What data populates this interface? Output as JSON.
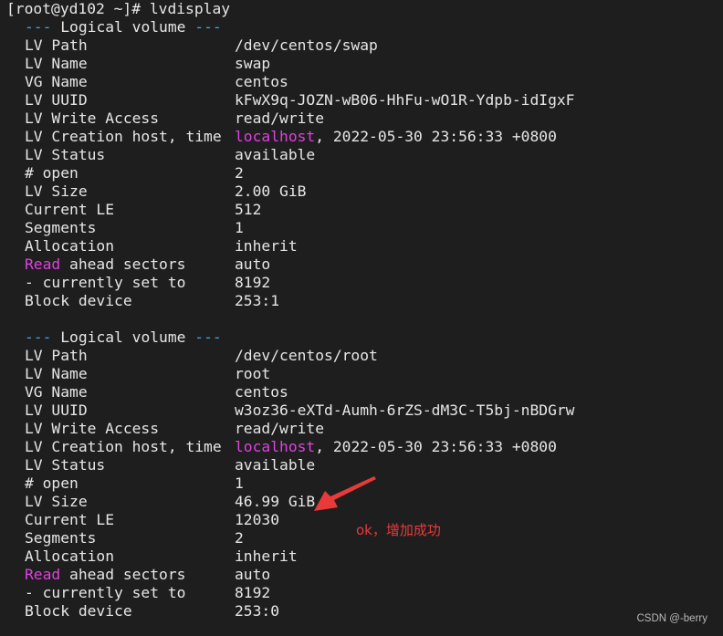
{
  "prompt": "[root@yd102 ~]# lvdisplay",
  "volumes": [
    {
      "header": {
        "dashes_left": "---",
        "title": "Logical volume",
        "dashes_right": "---"
      },
      "fields": [
        {
          "label": "LV Path",
          "value": "/dev/centos/swap"
        },
        {
          "label": "LV Name",
          "value": "swap"
        },
        {
          "label": "VG Name",
          "value": "centos"
        },
        {
          "label": "LV UUID",
          "value": "kFwX9q-JOZN-wB06-HhFu-wO1R-Ydpb-idIgxF"
        },
        {
          "label": "LV Write Access",
          "value": "read/write"
        },
        {
          "label": "LV Creation host, time",
          "value_host": "localhost",
          "value": ", 2022-05-30 23:56:33 +0800"
        },
        {
          "label": "LV Status",
          "value": "available"
        },
        {
          "label": "# open",
          "value": "2"
        },
        {
          "label": "LV Size",
          "value": "2.00 GiB"
        },
        {
          "label": "Current LE",
          "value": "512"
        },
        {
          "label": "Segments",
          "value": "1"
        },
        {
          "label": "Allocation",
          "value": "inherit"
        },
        {
          "label_hl": "Read",
          "label": " ahead sectors",
          "value": "auto"
        },
        {
          "label": "- currently set to",
          "value": "8192"
        },
        {
          "label": "Block device",
          "value": "253:1"
        }
      ]
    },
    {
      "header": {
        "dashes_left": "---",
        "title": "Logical volume",
        "dashes_right": "---"
      },
      "fields": [
        {
          "label": "LV Path",
          "value": "/dev/centos/root"
        },
        {
          "label": "LV Name",
          "value": "root"
        },
        {
          "label": "VG Name",
          "value": "centos"
        },
        {
          "label": "LV UUID",
          "value": "w3oz36-eXTd-Aumh-6rZS-dM3C-T5bj-nBDGrw"
        },
        {
          "label": "LV Write Access",
          "value": "read/write"
        },
        {
          "label": "LV Creation host, time",
          "value_host": "localhost",
          "value": ", 2022-05-30 23:56:33 +0800"
        },
        {
          "label": "LV Status",
          "value": "available"
        },
        {
          "label": "# open",
          "value": "1"
        },
        {
          "label": "LV Size",
          "value": "46.99 GiB"
        },
        {
          "label": "Current LE",
          "value": "12030"
        },
        {
          "label": "Segments",
          "value": "2"
        },
        {
          "label": "Allocation",
          "value": "inherit"
        },
        {
          "label_hl": "Read",
          "label": " ahead sectors",
          "value": "auto"
        },
        {
          "label": "- currently set to",
          "value": "8192"
        },
        {
          "label": "Block device",
          "value": "253:0"
        }
      ]
    }
  ],
  "annotation": {
    "text": "ok，增加成功",
    "color": "#e83a3a",
    "arrow_icon": "red-arrow-icon"
  },
  "watermark": "CSDN @-berry",
  "colors": {
    "background": "#1e1e1e",
    "text": "#e6e6e6",
    "dash": "#3aa8e0",
    "highlight": "#e040e0"
  }
}
